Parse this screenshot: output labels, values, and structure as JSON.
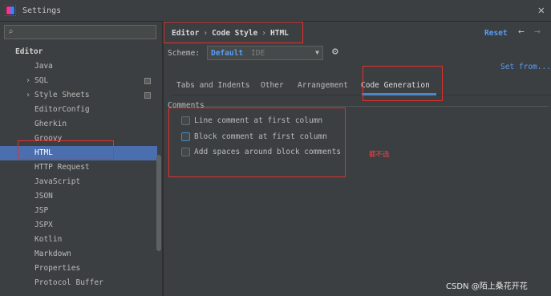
{
  "window": {
    "title": "Settings"
  },
  "search": {
    "placeholder": "",
    "value": ""
  },
  "sidebar": {
    "section": "Editor",
    "items": [
      {
        "label": "Java"
      },
      {
        "label": "SQL"
      },
      {
        "label": "Style Sheets"
      },
      {
        "label": "EditorConfig"
      },
      {
        "label": "Gherkin"
      },
      {
        "label": "Groovy"
      },
      {
        "label": "HTML"
      },
      {
        "label": "HTTP Request"
      },
      {
        "label": "JavaScript"
      },
      {
        "label": "JSON"
      },
      {
        "label": "JSP"
      },
      {
        "label": "JSPX"
      },
      {
        "label": "Kotlin"
      },
      {
        "label": "Markdown"
      },
      {
        "label": "Properties"
      },
      {
        "label": "Protocol Buffer"
      }
    ]
  },
  "header": {
    "breadcrumb": [
      "Editor",
      "Code Style",
      "HTML"
    ],
    "breadcrumb_sep": "›",
    "reset": "Reset",
    "back_icon": "←",
    "forward_icon": "→"
  },
  "scheme": {
    "label": "Scheme:",
    "value": "Default",
    "sub": "IDE",
    "set_from": "Set from..."
  },
  "tabs": [
    {
      "label": "Tabs and Indents"
    },
    {
      "label": "Other"
    },
    {
      "label": "Arrangement"
    },
    {
      "label": "Code Generation"
    }
  ],
  "comments": {
    "title": "Comments",
    "options": [
      {
        "label": "Line comment at first column",
        "checked": false
      },
      {
        "label": "Block comment at first column",
        "checked": false
      },
      {
        "label": "Add spaces around block comments",
        "checked": false
      }
    ]
  },
  "annotation": {
    "note": "都不选"
  },
  "watermark": "CSDN @陌上桑花开花",
  "colors": {
    "accent": "#589df6",
    "selection": "#4b6eaf",
    "annotation": "#e0302e"
  }
}
